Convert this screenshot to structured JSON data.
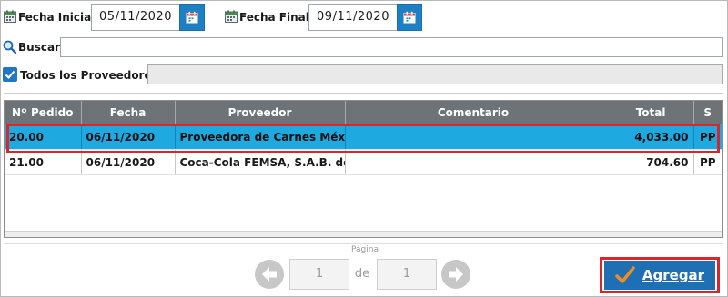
{
  "filters": {
    "fecha_inicial_label": "Fecha Inicial:",
    "fecha_inicial_value": "05/11/2020",
    "fecha_final_label": "Fecha Final:",
    "fecha_final_value": "09/11/2020",
    "buscar_label": "Buscar",
    "buscar_value": "",
    "todos_label": "Todos los Proveedores",
    "todos_checked": true
  },
  "table": {
    "columns": [
      "Nº Pedido",
      "Fecha",
      "Proveedor",
      "Comentario",
      "Total",
      "S"
    ],
    "rows": [
      {
        "pedido": "20.00",
        "fecha": "06/11/2020",
        "proveedor": "Proveedora de Carnes Méxic...",
        "comentario": "",
        "total": "4,033.00",
        "s": "PP",
        "selected": true
      },
      {
        "pedido": "21.00",
        "fecha": "06/11/2020",
        "proveedor": "Coca-Cola FEMSA, S.A.B. de ...",
        "comentario": "",
        "total": "704.60",
        "s": "PP",
        "selected": false
      }
    ]
  },
  "pagination": {
    "label": "Página",
    "current": "1",
    "of_label": "de",
    "total": "1"
  },
  "actions": {
    "agregar_label": "Agregar"
  },
  "colors": {
    "header_bg": "#6e7378",
    "selected_row": "#1ea9e1",
    "accent": "#1f6fb4",
    "highlight": "#d9262b"
  }
}
